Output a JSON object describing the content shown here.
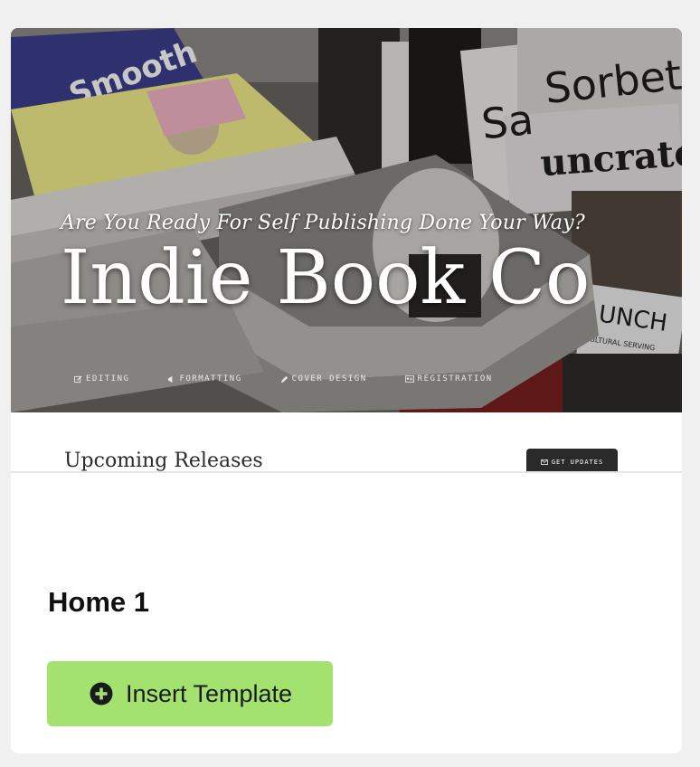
{
  "preview": {
    "tagline": "Are You Ready For Self Publishing Done Your Way?",
    "title": "Indie Book Co",
    "nav": [
      {
        "label": "EDITING",
        "icon": "edit-icon"
      },
      {
        "label": "FORMATTING",
        "icon": "megaphone-icon"
      },
      {
        "label": "COVER DESIGN",
        "icon": "pencil-icon"
      },
      {
        "label": "REGISTRATION",
        "icon": "id-card-icon"
      }
    ],
    "magazines": {
      "mag1": "Sorbet",
      "mag2": "uncrate",
      "mag3": "Sa",
      "mag4": "UNCH",
      "mag5": "Smooth",
      "mag6": "A CULTURAL SERVING"
    },
    "section_title": "Upcoming Releases",
    "get_updates_label": "GET UPDATES"
  },
  "card": {
    "title": "Home 1",
    "insert_label": "Insert Template",
    "insert_icon": "plus-circle-icon"
  },
  "colors": {
    "page_bg": "#f0f0f0",
    "card_bg": "#ffffff",
    "insert_button_bg": "#a3e26e",
    "dark_button_bg": "#2a2a2a"
  }
}
